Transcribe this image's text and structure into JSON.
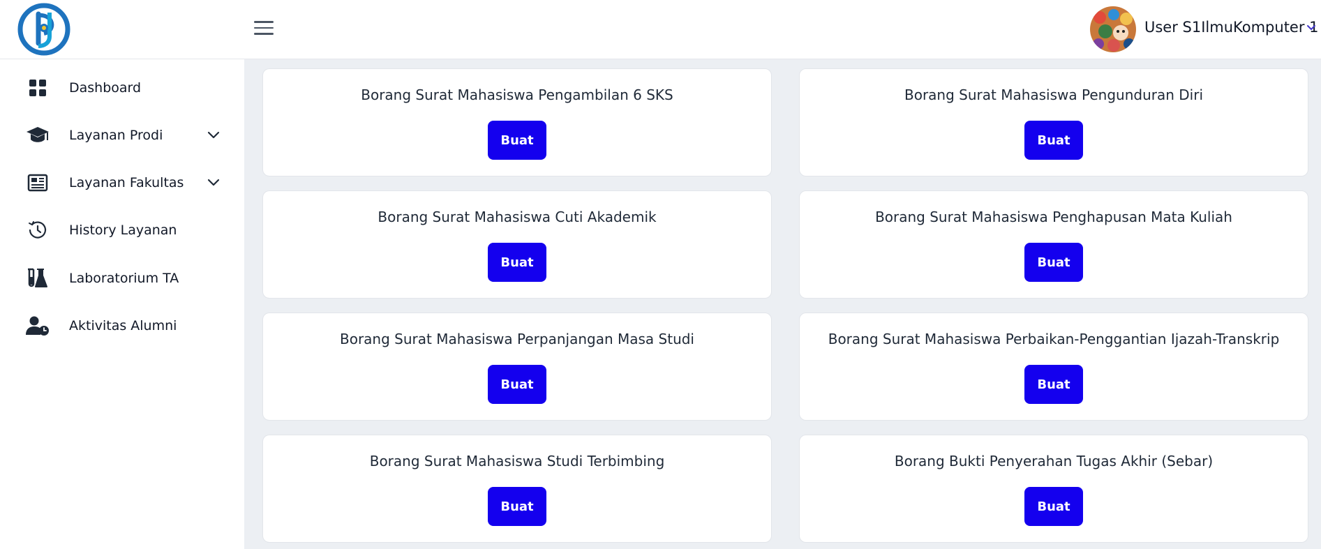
{
  "header": {
    "user_name": "User S1IlmuKomputer 1"
  },
  "sidebar": {
    "items": [
      {
        "label": "Dashboard",
        "icon": "dashboard-icon",
        "has_submenu": false
      },
      {
        "label": "Layanan Prodi",
        "icon": "graduation-cap-icon",
        "has_submenu": true
      },
      {
        "label": "Layanan Fakultas",
        "icon": "newspaper-icon",
        "has_submenu": true
      },
      {
        "label": "History Layanan",
        "icon": "history-clock-icon",
        "has_submenu": false
      },
      {
        "label": "Laboratorium TA",
        "icon": "flask-icon",
        "has_submenu": false
      },
      {
        "label": "Aktivitas Alumni",
        "icon": "user-clock-icon",
        "has_submenu": false
      }
    ]
  },
  "cards": [
    {
      "title": "Borang Surat Mahasiswa Pengambilan 6 SKS",
      "button": "Buat"
    },
    {
      "title": "Borang Surat Mahasiswa Pengunduran Diri",
      "button": "Buat"
    },
    {
      "title": "Borang Surat Mahasiswa Cuti Akademik",
      "button": "Buat"
    },
    {
      "title": "Borang Surat Mahasiswa Penghapusan Mata Kuliah",
      "button": "Buat"
    },
    {
      "title": "Borang Surat Mahasiswa Perpanjangan Masa Studi",
      "button": "Buat"
    },
    {
      "title": "Borang Surat Mahasiswa Perbaikan-Penggantian Ijazah-Transkrip",
      "button": "Buat"
    },
    {
      "title": "Borang Surat Mahasiswa Studi Terbimbing",
      "button": "Buat"
    },
    {
      "title": "Borang Bukti Penyerahan Tugas Akhir (Sebar)",
      "button": "Buat"
    }
  ],
  "colors": {
    "primary_button": "#1400ee",
    "main_background": "#eceff3",
    "logo_blue": "#1e73be"
  }
}
